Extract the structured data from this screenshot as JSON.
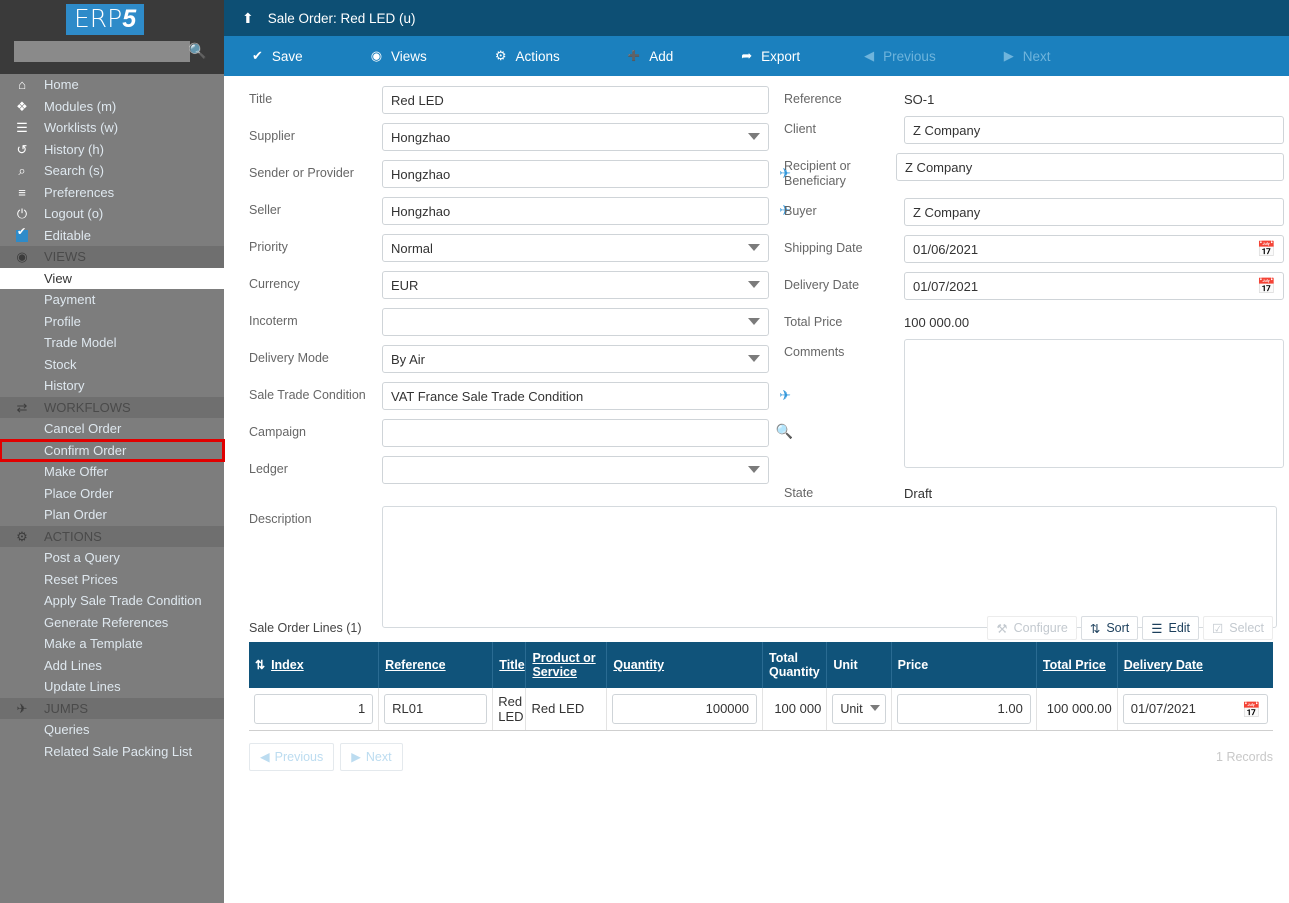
{
  "sidebar": {
    "logo": {
      "part1": "ERP",
      "part2": "5"
    },
    "search_placeholder": "",
    "search_value": "",
    "search_icon": "search-icon",
    "items": [
      {
        "label": "Home",
        "icon": "home-icon",
        "type": "link"
      },
      {
        "label": "Modules (m)",
        "icon": "modules-icon",
        "type": "link"
      },
      {
        "label": "Worklists (w)",
        "icon": "worklists-icon",
        "type": "link"
      },
      {
        "label": "History (h)",
        "icon": "history-icon",
        "type": "link"
      },
      {
        "label": "Search (s)",
        "icon": "search-icon",
        "type": "link"
      },
      {
        "label": "Preferences",
        "icon": "preferences-icon",
        "type": "link"
      },
      {
        "label": "Logout (o)",
        "icon": "power-icon",
        "type": "link"
      },
      {
        "label": "Editable",
        "icon": "checkbox-checked-icon",
        "type": "checkbox"
      },
      {
        "label": "VIEWS",
        "icon": "eye-icon",
        "type": "group"
      },
      {
        "label": "View",
        "icon": "",
        "type": "active"
      },
      {
        "label": "Payment",
        "icon": "",
        "type": "link"
      },
      {
        "label": "Profile",
        "icon": "",
        "type": "link"
      },
      {
        "label": "Trade Model",
        "icon": "",
        "type": "link"
      },
      {
        "label": "Stock",
        "icon": "",
        "type": "link"
      },
      {
        "label": "History",
        "icon": "",
        "type": "link"
      },
      {
        "label": "WORKFLOWS",
        "icon": "workflow-icon",
        "type": "group"
      },
      {
        "label": "Cancel Order",
        "icon": "",
        "type": "link"
      },
      {
        "label": "Confirm Order",
        "icon": "",
        "type": "highlight"
      },
      {
        "label": "Make Offer",
        "icon": "",
        "type": "link"
      },
      {
        "label": "Place Order",
        "icon": "",
        "type": "link"
      },
      {
        "label": "Plan Order",
        "icon": "",
        "type": "link"
      },
      {
        "label": "ACTIONS",
        "icon": "actions-gear-icon",
        "type": "group"
      },
      {
        "label": "Post a Query",
        "icon": "",
        "type": "link"
      },
      {
        "label": "Reset Prices",
        "icon": "",
        "type": "link"
      },
      {
        "label": "Apply Sale Trade Condition",
        "icon": "",
        "type": "link"
      },
      {
        "label": "Generate References",
        "icon": "",
        "type": "link"
      },
      {
        "label": "Make a Template",
        "icon": "",
        "type": "link"
      },
      {
        "label": "Add Lines",
        "icon": "",
        "type": "link"
      },
      {
        "label": "Update Lines",
        "icon": "",
        "type": "link"
      },
      {
        "label": "JUMPS",
        "icon": "plane-icon",
        "type": "group"
      },
      {
        "label": "Queries",
        "icon": "",
        "type": "link"
      },
      {
        "label": "Related Sale Packing List",
        "icon": "",
        "type": "link"
      }
    ]
  },
  "header": {
    "title": "Sale Order: Red LED (u)",
    "up_icon": "arrow-up-icon"
  },
  "toolbar": {
    "buttons": [
      {
        "label": "Save",
        "icon": "check-icon",
        "enabled": true
      },
      {
        "label": "Views",
        "icon": "eye-icon",
        "enabled": true
      },
      {
        "label": "Actions",
        "icon": "gear-icon",
        "enabled": true
      },
      {
        "label": "Add",
        "icon": "plus-icon",
        "enabled": true
      },
      {
        "label": "Export",
        "icon": "export-icon",
        "enabled": true
      },
      {
        "label": "Previous",
        "icon": "caret-left-icon",
        "enabled": false
      },
      {
        "label": "Next",
        "icon": "caret-right-icon",
        "enabled": false
      }
    ]
  },
  "form": {
    "left": {
      "title_label": "Title",
      "title_value": "Red LED",
      "supplier_label": "Supplier",
      "supplier_value": "Hongzhao",
      "sender_label": "Sender or Provider",
      "sender_value": "Hongzhao",
      "seller_label": "Seller",
      "seller_value": "Hongzhao",
      "priority_label": "Priority",
      "priority_value": "Normal",
      "currency_label": "Currency",
      "currency_value": "EUR",
      "incoterm_label": "Incoterm",
      "incoterm_value": "",
      "delivery_mode_label": "Delivery Mode",
      "delivery_mode_value": "By Air",
      "stc_label": "Sale Trade Condition",
      "stc_value": "VAT France Sale Trade Condition",
      "campaign_label": "Campaign",
      "campaign_value": "",
      "ledger_label": "Ledger",
      "ledger_value": "",
      "description_label": "Description",
      "description_value": ""
    },
    "right": {
      "reference_label": "Reference",
      "reference_value": "SO-1",
      "client_label": "Client",
      "client_value": "Z Company",
      "recipient_label": "Recipient or Beneficiary",
      "recipient_value": "Z Company",
      "buyer_label": "Buyer",
      "buyer_value": "Z Company",
      "shipping_date_label": "Shipping Date",
      "shipping_date_value": "01/06/2021",
      "delivery_date_label": "Delivery Date",
      "delivery_date_value": "01/07/2021",
      "total_price_label": "Total Price",
      "total_price_value": "100 000.00",
      "comments_label": "Comments",
      "comments_value": "",
      "state_label": "State",
      "state_value": "Draft"
    }
  },
  "listbox": {
    "title": "Sale Order Lines (1)",
    "buttons": [
      {
        "label": "Configure",
        "icon": "wrench-icon",
        "enabled": false
      },
      {
        "label": "Sort",
        "icon": "sort-icon",
        "enabled": true
      },
      {
        "label": "Edit",
        "icon": "list-icon",
        "enabled": true
      },
      {
        "label": "Select",
        "icon": "checkbox-icon",
        "enabled": false
      }
    ],
    "columns": [
      {
        "label": "Index",
        "sortable": true,
        "sort_icon": "sort-asc-icon"
      },
      {
        "label": "Reference",
        "sortable": true
      },
      {
        "label": "Title",
        "sortable": true
      },
      {
        "label": "Product or Service",
        "sortable": true
      },
      {
        "label": "Quantity",
        "sortable": true
      },
      {
        "label": "Total Quantity",
        "sortable": false
      },
      {
        "label": "Unit",
        "sortable": false
      },
      {
        "label": "Price",
        "sortable": false
      },
      {
        "label": "Total Price",
        "sortable": true
      },
      {
        "label": "Delivery Date",
        "sortable": true
      }
    ],
    "rows": [
      {
        "index": "1",
        "reference": "RL01",
        "title": "Red LED",
        "product_or_service": "Red LED",
        "quantity": "100000",
        "total_quantity": "100 000",
        "unit": "Unit/P",
        "price": "1.00",
        "total_price": "100 000.00",
        "delivery_date": "01/07/2021"
      }
    ],
    "footer": {
      "previous_label": "Previous",
      "next_label": "Next",
      "records_label": "1 Records"
    }
  },
  "colors": {
    "header_bg": "#0d4f74",
    "toolbar_bg": "#1b80be",
    "sidebar_bg": "#7d7d7d",
    "sidebar_top_bg": "#3a3a3a",
    "table_header_bg": "#10537a",
    "accent": "#2e8bc9",
    "highlight_outline": "#e00000",
    "link_icon": "#3498db"
  }
}
